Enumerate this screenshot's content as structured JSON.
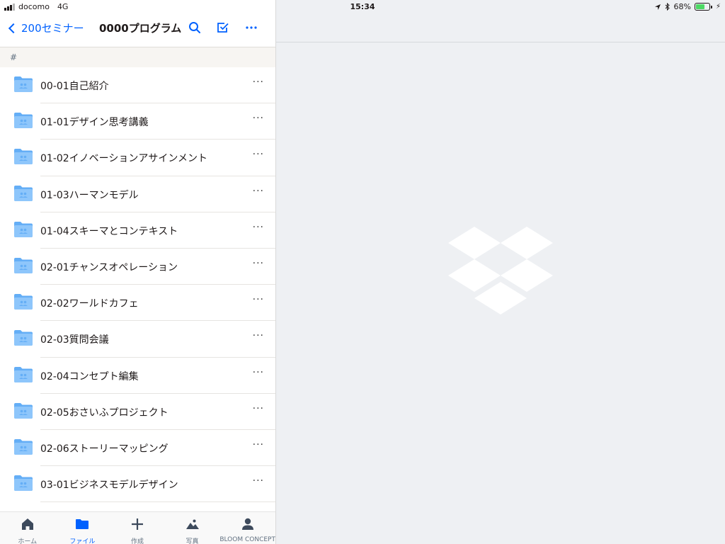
{
  "status_bar": {
    "carrier": "docomo",
    "network": "4G",
    "time": "15:34",
    "battery_percent": "68%",
    "battery_level": 0.68
  },
  "nav": {
    "back_label": "200セミナー",
    "title": "0000プログラム",
    "actions": [
      "search-icon",
      "select-icon",
      "more-icon"
    ]
  },
  "section_header": "#",
  "files": [
    {
      "name": "00-01自己紹介"
    },
    {
      "name": "01-01デザイン思考講義"
    },
    {
      "name": "01-02イノベーションアサインメント"
    },
    {
      "name": "01-03ハーマンモデル"
    },
    {
      "name": "01-04スキーマとコンテキスト"
    },
    {
      "name": "02-01チャンスオペレーション"
    },
    {
      "name": "02-02ワールドカフェ"
    },
    {
      "name": "02-03質問会議"
    },
    {
      "name": "02-04コンセプト編集"
    },
    {
      "name": "02-05おさいふプロジェクト"
    },
    {
      "name": "02-06ストーリーマッピング"
    },
    {
      "name": "03-01ビジネスモデルデザイン"
    }
  ],
  "more_label": "···",
  "tabs": [
    {
      "label": "ホーム",
      "icon": "home-icon",
      "active": false
    },
    {
      "label": "ファイル",
      "icon": "folder-icon",
      "active": true
    },
    {
      "label": "作成",
      "icon": "plus-icon",
      "active": false
    },
    {
      "label": "写真",
      "icon": "photo-icon",
      "active": false
    },
    {
      "label": "BLOOM CONCEPT",
      "icon": "account-icon",
      "active": false
    }
  ],
  "colors": {
    "accent": "#0061fe",
    "folder": "#8ec6fb",
    "folder_dark": "#64aef6",
    "logo": "#ffffff"
  }
}
